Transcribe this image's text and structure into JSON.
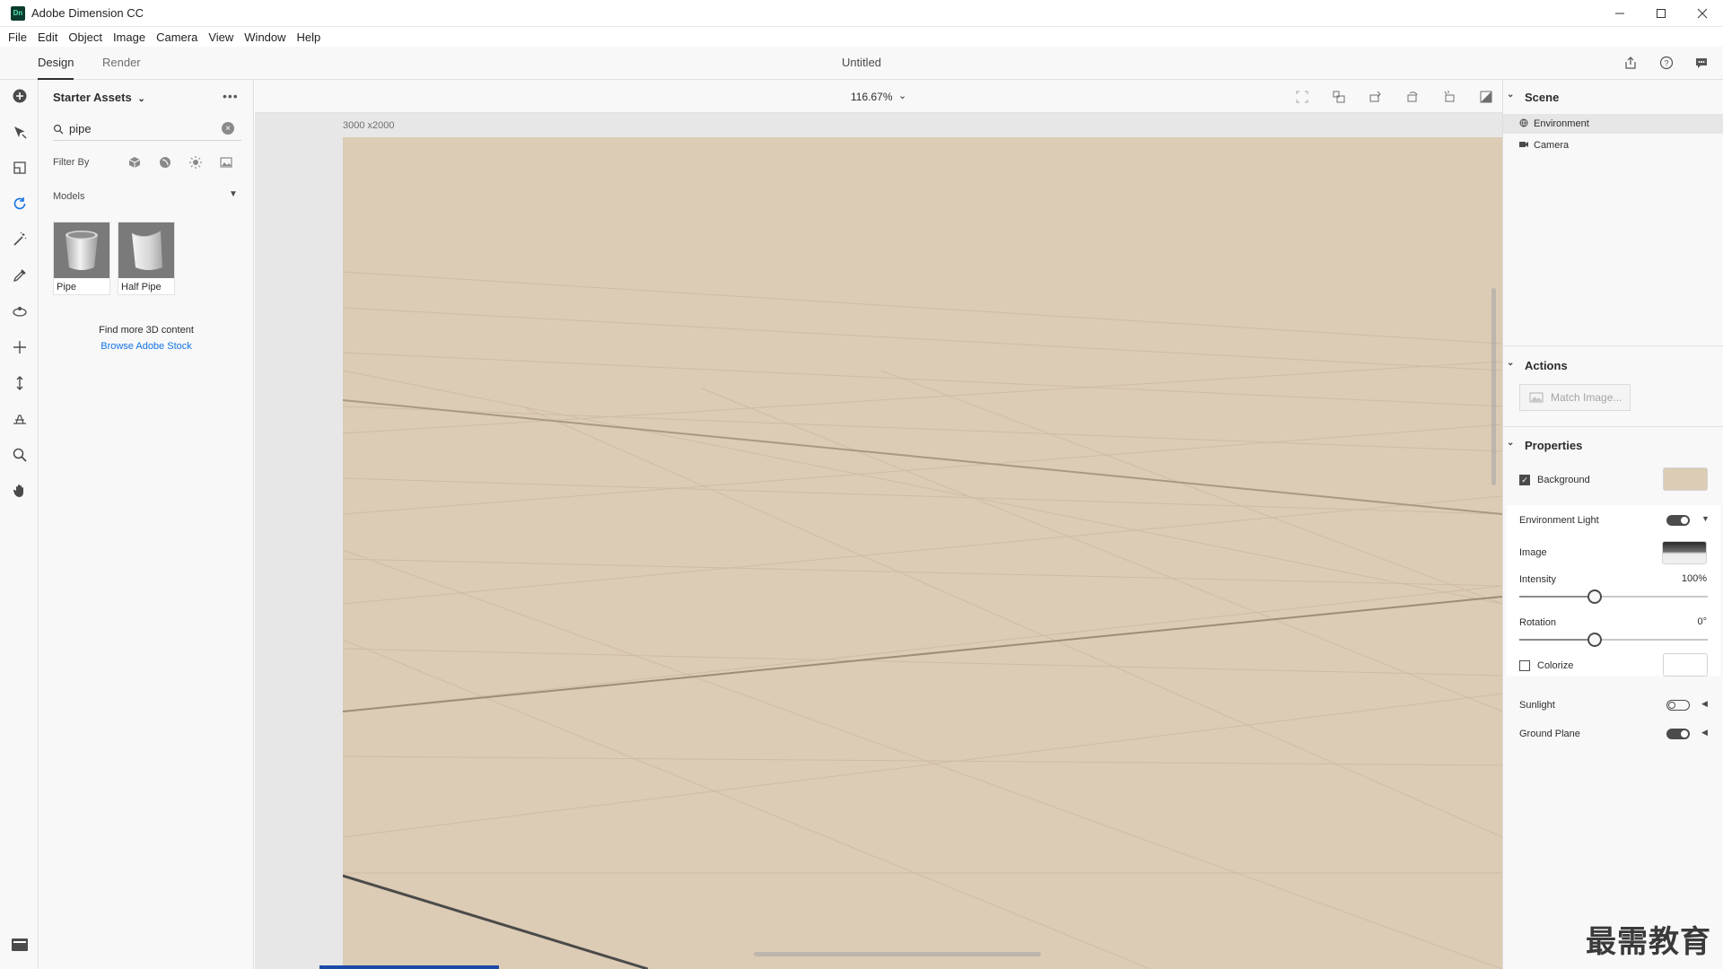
{
  "window": {
    "title": "Adobe Dimension CC",
    "logo_text": "Dn",
    "controls": [
      "minimize",
      "maximize",
      "close"
    ]
  },
  "menu": [
    "File",
    "Edit",
    "Object",
    "Image",
    "Camera",
    "View",
    "Window",
    "Help"
  ],
  "header": {
    "tabs": [
      {
        "label": "Design",
        "active": true
      },
      {
        "label": "Render",
        "active": false
      }
    ],
    "document_title": "Untitled",
    "right_icons": [
      "share-icon",
      "help-icon",
      "comment-icon"
    ]
  },
  "toolbar": {
    "tools": [
      {
        "name": "add-content-icon",
        "active": false
      },
      {
        "name": "select-tool-icon",
        "active": false
      },
      {
        "name": "move-tool-icon",
        "active": false
      },
      {
        "name": "rotate-tool-icon",
        "active": true
      },
      {
        "name": "magic-wand-tool-icon",
        "active": false
      },
      {
        "name": "eyedropper-tool-icon",
        "active": false
      },
      {
        "name": "orbit-tool-icon",
        "active": false
      },
      {
        "name": "pan-tool-icon",
        "active": false
      },
      {
        "name": "dolly-tool-icon",
        "active": false
      },
      {
        "name": "horizon-tool-icon",
        "active": false
      },
      {
        "name": "zoom-tool-icon",
        "active": false
      },
      {
        "name": "hand-tool-icon",
        "active": false
      }
    ],
    "bottom_icon": "panel-toggle-icon"
  },
  "assets": {
    "title": "Starter Assets",
    "search_value": "pipe",
    "filter_label": "Filter By",
    "filters": [
      "model-filter-icon",
      "material-filter-icon",
      "light-filter-icon",
      "image-filter-icon"
    ],
    "section_label": "Models",
    "items": [
      {
        "label": "Pipe"
      },
      {
        "label": "Half Pipe"
      }
    ],
    "find_more": "Find more 3D content",
    "browse_link": "Browse Adobe Stock"
  },
  "canvas": {
    "zoom": "116.67%",
    "size_label": "3000 x2000",
    "background_color": "#dccbb5",
    "tools": [
      "frame-icon",
      "align-icon",
      "drop-to-ground-icon",
      "rotate-view-icon",
      "snap-icon",
      "render-preview-icon"
    ]
  },
  "scene": {
    "title": "Scene",
    "items": [
      {
        "label": "Environment",
        "icon": "environment-icon",
        "selected": true
      },
      {
        "label": "Camera",
        "icon": "camera-icon",
        "selected": false
      }
    ]
  },
  "actions": {
    "title": "Actions",
    "match_image": "Match Image..."
  },
  "properties": {
    "title": "Properties",
    "background": {
      "label": "Background",
      "checked": true,
      "color": "#dccbb5"
    },
    "environment_light": {
      "label": "Environment Light",
      "on": true
    },
    "image": {
      "label": "Image"
    },
    "intensity": {
      "label": "Intensity",
      "value_text": "100%",
      "level": 0.4
    },
    "rotation": {
      "label": "Rotation",
      "value_text": "0°",
      "level": 0.4
    },
    "colorize": {
      "label": "Colorize",
      "checked": false,
      "color": "#ffffff"
    },
    "sunlight": {
      "label": "Sunlight",
      "on": false
    },
    "ground_plane": {
      "label": "Ground Plane",
      "on": true
    }
  },
  "watermark": "最需教育"
}
